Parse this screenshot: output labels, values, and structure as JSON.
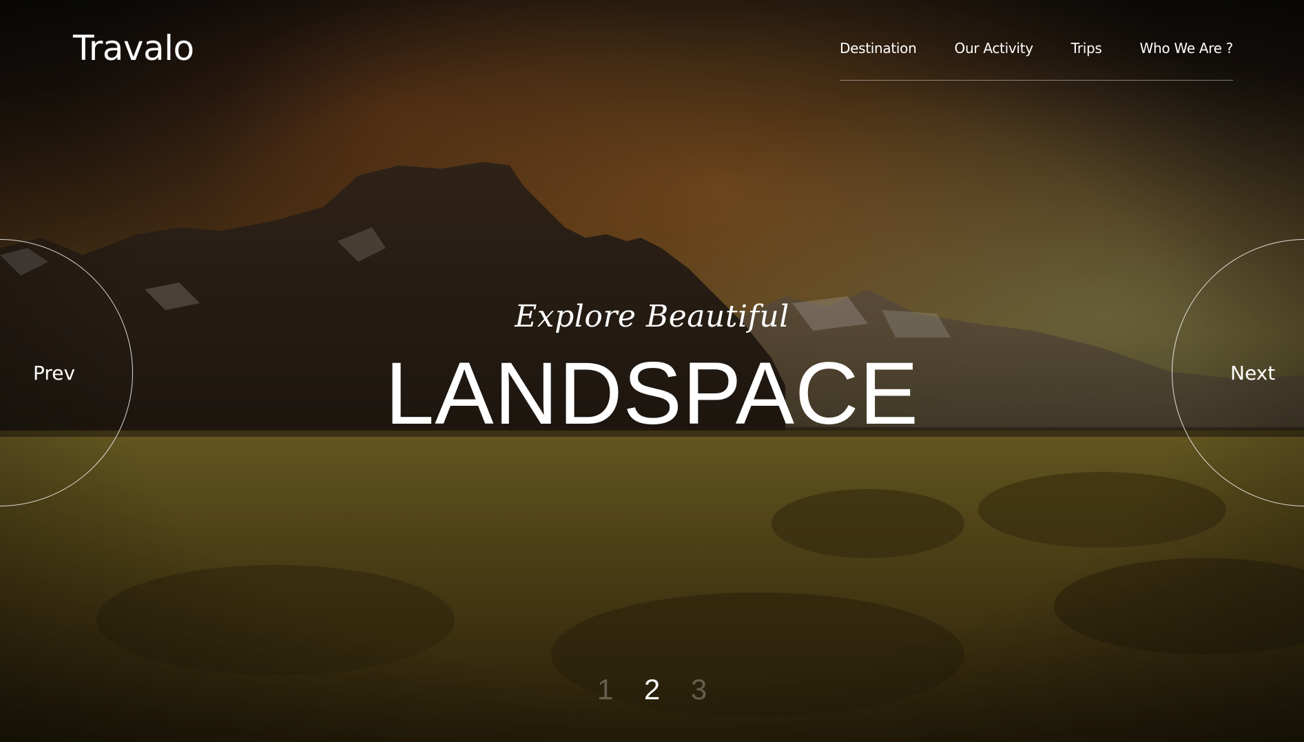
{
  "brand": {
    "logo": "Travalo"
  },
  "nav": {
    "items": [
      {
        "label": "Destination"
      },
      {
        "label": "Our Activity"
      },
      {
        "label": "Trips"
      },
      {
        "label": "Who We Are ?"
      }
    ]
  },
  "slider": {
    "prev_label": "Prev",
    "next_label": "Next",
    "subtitle": "Explore Beautiful",
    "title": "LANDSPACE",
    "pages": [
      "1",
      "2",
      "3"
    ],
    "active_page": 2
  },
  "colors": {
    "text": "#ffffff",
    "inactive_page": "#5a5146",
    "sky_dark": "#1c1712",
    "sky_glow": "#8a5a22",
    "grass": "#6b5a1e"
  }
}
